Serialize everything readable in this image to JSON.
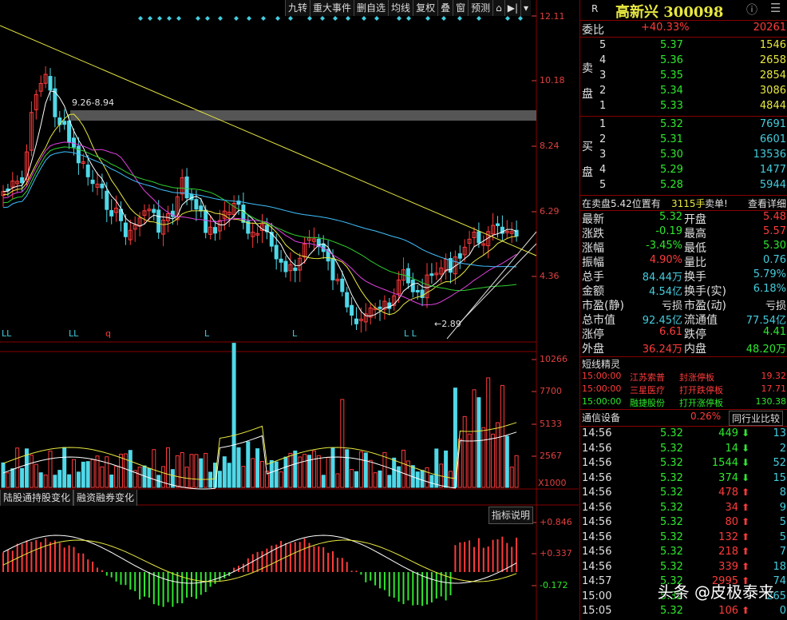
{
  "toolbar": [
    "九转",
    "重大事件",
    "删自选",
    "均线",
    "复权",
    "叠",
    "窗",
    "预测"
  ],
  "chart": {
    "price_labels": [
      "12.11",
      "10.18",
      "8.24",
      "6.29",
      "4.36"
    ],
    "trend_note": "9.26-8.94",
    "low_note": "←2.89",
    "markers": [
      "LL",
      "LL",
      "q",
      "L",
      "L",
      "L L"
    ],
    "vol_labels": [
      "10266",
      "7700",
      "5133",
      "2567",
      "X1000"
    ],
    "ind_labels": [
      "+0.846",
      "+0.337",
      "-0.172"
    ],
    "tabs": [
      "陆股通持股变化",
      "融资融券变化"
    ],
    "ind_btn": "指标说明"
  },
  "quote": {
    "badge": "R",
    "title": "高新兴 300098",
    "weibi_label": "委比",
    "weibi_pct": "+40.33%",
    "weibi_val": "20261",
    "sell_label": [
      "卖",
      "盘"
    ],
    "buy_label": [
      "买",
      "盘"
    ],
    "sells": [
      {
        "lv": "5",
        "price": "5.37",
        "vol": "1546"
      },
      {
        "lv": "4",
        "price": "5.36",
        "vol": "2658"
      },
      {
        "lv": "3",
        "price": "5.35",
        "vol": "2854"
      },
      {
        "lv": "2",
        "price": "5.34",
        "vol": "3086"
      },
      {
        "lv": "1",
        "price": "5.33",
        "vol": "4844"
      }
    ],
    "buys": [
      {
        "lv": "1",
        "price": "5.32",
        "vol": "7691"
      },
      {
        "lv": "2",
        "price": "5.31",
        "vol": "6601"
      },
      {
        "lv": "3",
        "price": "5.30",
        "vol": "13536"
      },
      {
        "lv": "4",
        "price": "5.29",
        "vol": "1477"
      },
      {
        "lv": "5",
        "price": "5.28",
        "vol": "5944"
      }
    ],
    "notice_a": "在卖盘5.42位置有",
    "notice_b": "3115手",
    "notice_c": "卖单!",
    "notice_d": "查看详细",
    "stats": [
      {
        "l1": "最新",
        "v1": "5.32",
        "l2": "开盘",
        "v2": "5.48"
      },
      {
        "l1": "涨跌",
        "v1": "-0.19",
        "l2": "最高",
        "v2": "5.57"
      },
      {
        "l1": "涨幅",
        "v1": "-3.45%",
        "l2": "最低",
        "v2": "5.30"
      },
      {
        "l1": "振幅",
        "v1": "4.90%",
        "l2": "量比",
        "v2": "0.76"
      },
      {
        "l1": "总手",
        "v1": "84.44万",
        "l2": "换手",
        "v2": "5.79%"
      },
      {
        "l1": "金额",
        "v1": "4.54亿",
        "l2": "换手(实)",
        "v2": "6.18%"
      },
      {
        "l1": "市盈(静)",
        "v1": "亏损",
        "l2": "市盈(动)",
        "v2": "亏损"
      },
      {
        "l1": "总市值",
        "v1": "92.45亿",
        "l2": "流通值",
        "v2": "77.54亿"
      },
      {
        "l1": "涨停",
        "v1": "6.61",
        "l2": "跌停",
        "v2": "4.41"
      },
      {
        "l1": "外盘",
        "v1": "36.24万",
        "l2": "内盘",
        "v2": "48.20万"
      }
    ],
    "short_title": "短线精灵",
    "short_items": [
      {
        "time": "15:00:00",
        "name": "江苏索普",
        "event": "封涨停板",
        "val": "19.32"
      },
      {
        "time": "15:00:00",
        "name": "三星医疗",
        "event": "打开跌停板",
        "val": "17.71"
      },
      {
        "time": "15:00:00",
        "name": "融捷股份",
        "event": "打开涨停板",
        "val": "130.38"
      }
    ],
    "sector_name": "通信设备",
    "sector_pct": "0.26%",
    "sector_btn": "同行业比较",
    "ticks": [
      {
        "t": "14:56",
        "p": "5.32",
        "v": "449",
        "d": "down",
        "n": "13"
      },
      {
        "t": "14:56",
        "p": "5.32",
        "v": "14",
        "d": "down",
        "n": "2"
      },
      {
        "t": "14:56",
        "p": "5.32",
        "v": "1544",
        "d": "down",
        "n": "52"
      },
      {
        "t": "14:56",
        "p": "5.32",
        "v": "374",
        "d": "down",
        "n": "15"
      },
      {
        "t": "14:56",
        "p": "5.32",
        "v": "478",
        "d": "up",
        "n": "8"
      },
      {
        "t": "14:56",
        "p": "5.32",
        "v": "34",
        "d": "up",
        "n": "9"
      },
      {
        "t": "14:56",
        "p": "5.32",
        "v": "80",
        "d": "up",
        "n": "5"
      },
      {
        "t": "14:56",
        "p": "5.32",
        "v": "132",
        "d": "up",
        "n": "5"
      },
      {
        "t": "14:56",
        "p": "5.32",
        "v": "218",
        "d": "up",
        "n": "7"
      },
      {
        "t": "14:56",
        "p": "5.32",
        "v": "339",
        "d": "up",
        "n": "18"
      },
      {
        "t": "14:57",
        "p": "5.32",
        "v": "2995",
        "d": "up",
        "n": "74"
      },
      {
        "t": "15:00",
        "p": "5.32",
        "v": "",
        "d": "",
        "n": "265"
      },
      {
        "t": "15:05",
        "p": "5.32",
        "v": "106",
        "d": "up",
        "n": "0"
      }
    ]
  },
  "watermark": "头条 @皮极泰来",
  "colors": {
    "up": "#ff3b3b",
    "down": "#2ee82e",
    "neutral": "#44ccdd"
  }
}
